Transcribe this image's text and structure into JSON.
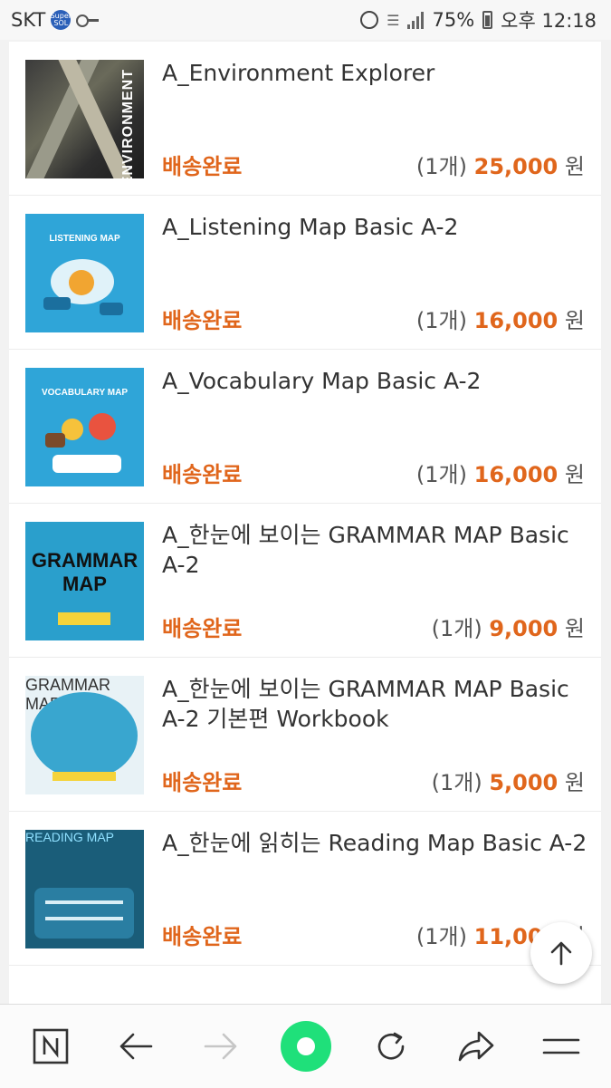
{
  "status_bar": {
    "carrier": "SKT",
    "carrier_badge": "Super SOL",
    "battery": "75%",
    "time": "오후 12:18"
  },
  "orders": [
    {
      "title": "A_Environment Explorer",
      "status": "배송완료",
      "qty": "(1개)",
      "price": "25,000",
      "currency": "원",
      "cover_text": "ENVIRONMENT"
    },
    {
      "title": "A_Listening Map Basic A-2",
      "status": "배송완료",
      "qty": "(1개)",
      "price": "16,000",
      "currency": "원",
      "cover_text": "LISTENING MAP"
    },
    {
      "title": "A_Vocabulary Map Basic A-2",
      "status": "배송완료",
      "qty": "(1개)",
      "price": "16,000",
      "currency": "원",
      "cover_text": "VOCABULARY MAP"
    },
    {
      "title": "A_한눈에 보이는 GRAMMAR MAP Basic A-2",
      "status": "배송완료",
      "qty": "(1개)",
      "price": "9,000",
      "currency": "원",
      "cover_text": "GRAMMAR MAP"
    },
    {
      "title": "A_한눈에 보이는 GRAMMAR MAP Basic A-2 기본편 Workbook",
      "status": "배송완료",
      "qty": "(1개)",
      "price": "5,000",
      "currency": "원",
      "cover_text": "GRAMMAR MAP"
    },
    {
      "title": "A_한눈에 읽히는 Reading Map Basic A-2",
      "status": "배송완료",
      "qty": "(1개)",
      "price": "11,000",
      "currency": "원",
      "cover_text": "READING MAP"
    }
  ],
  "icons": {
    "scroll_top": "arrow-up-icon",
    "nav": [
      "naver-home-icon",
      "back-arrow-icon",
      "forward-arrow-icon",
      "green-dot-icon",
      "refresh-icon",
      "share-icon",
      "menu-icon"
    ]
  },
  "colors": {
    "accent": "#e0661c",
    "green": "#1fe07a"
  }
}
